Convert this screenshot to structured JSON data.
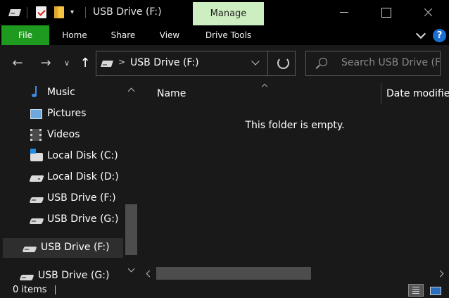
{
  "titlebar": {
    "title": "USB Drive (F:)",
    "context_tab": "Manage",
    "quick_access_dropdown": "▾"
  },
  "ribbon": {
    "tabs": [
      {
        "label": "File"
      },
      {
        "label": "Home"
      },
      {
        "label": "Share"
      },
      {
        "label": "View"
      },
      {
        "label": "Drive Tools"
      }
    ],
    "help": "?"
  },
  "nav": {
    "back": "←",
    "forward": "→",
    "recent": "∨",
    "up": "↑"
  },
  "address": {
    "separator": ">",
    "path": "USB Drive (F:)"
  },
  "search": {
    "placeholder": "Search USB Drive (F:)"
  },
  "sidebar": {
    "items": [
      {
        "label": "Music",
        "icon": "music-icon"
      },
      {
        "label": "Pictures",
        "icon": "pictures-icon"
      },
      {
        "label": "Videos",
        "icon": "videos-icon"
      },
      {
        "label": "Local Disk (C:)",
        "icon": "windows-disk-icon"
      },
      {
        "label": "Local Disk (D:)",
        "icon": "disk-icon"
      },
      {
        "label": "USB Drive (F:)",
        "icon": "usb-drive-icon"
      },
      {
        "label": "USB Drive (G:)",
        "icon": "usb-drive-icon"
      },
      {
        "label": "USB Drive (F:)",
        "icon": "usb-drive-icon",
        "selected": true
      },
      {
        "label": "USB Drive (G:)",
        "icon": "usb-drive-icon"
      }
    ]
  },
  "content": {
    "columns": [
      "Name",
      "Date modified"
    ],
    "empty_message": "This folder is empty."
  },
  "status": {
    "item_count": "0 items"
  },
  "colors": {
    "file_tab": "#1e9a1e",
    "manage_tab": "#cdeec0",
    "background": "#191919",
    "titlebar": "#000000"
  }
}
